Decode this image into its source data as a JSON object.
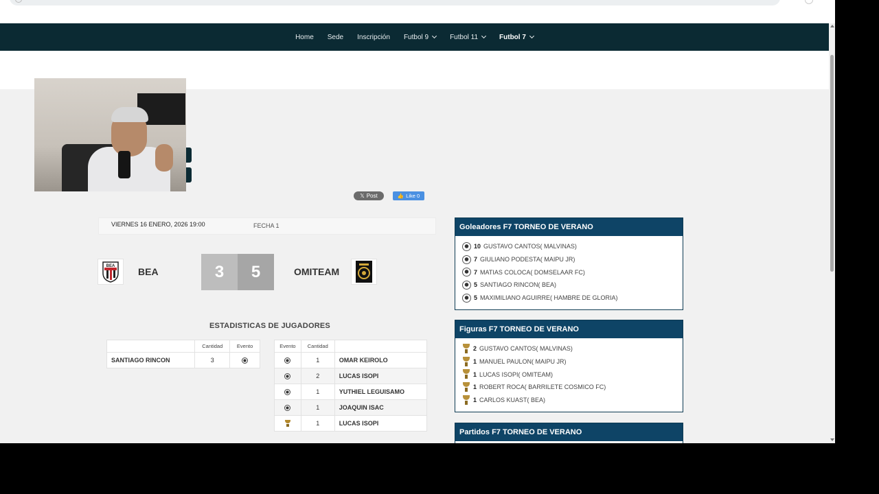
{
  "nav": {
    "items": [
      {
        "label": "Home"
      },
      {
        "label": "Sede"
      },
      {
        "label": "Inscripción"
      },
      {
        "label": "Futbol 9",
        "dropdown": true
      },
      {
        "label": "Futbol 11",
        "dropdown": true
      },
      {
        "label": "Futbol 7",
        "dropdown": true,
        "active": true
      }
    ]
  },
  "share": {
    "x_label": "Post",
    "fb_label": "Like 0"
  },
  "match": {
    "datetime": "VIERNES 16 ENERO, 2026 19:00",
    "round": "FECHA 1",
    "home_team": "BEA",
    "away_team": "OMITEAM",
    "home_score": "3",
    "away_score": "5",
    "home_logo_text": "BEA"
  },
  "stats": {
    "title": "ESTADISTICAS DE JUGADORES",
    "home": {
      "headers": {
        "col2": "Cantidad",
        "col3": "Evento"
      },
      "rows": [
        {
          "player": "SANTIAGO RINCON",
          "qty": "3",
          "event": "goal"
        }
      ]
    },
    "away": {
      "headers": {
        "col1": "Evento",
        "col2": "Cantidad"
      },
      "rows": [
        {
          "event": "goal",
          "qty": "1",
          "player": "OMAR KEIROLO"
        },
        {
          "event": "goal",
          "qty": "2",
          "player": "LUCAS ISOPI"
        },
        {
          "event": "goal",
          "qty": "1",
          "player": "YUTHIEL LEGUISAMO"
        },
        {
          "event": "goal",
          "qty": "1",
          "player": "JOAQUIN ISAC"
        },
        {
          "event": "figure",
          "qty": "1",
          "player": "LUCAS ISOPI"
        }
      ]
    }
  },
  "scorers": {
    "title": "Goleadores F7 TORNEO DE VERANO",
    "items": [
      {
        "count": "10",
        "name": "GUSTAVO CANTOS( MALVINAS)"
      },
      {
        "count": "7",
        "name": "GIULIANO PODESTA( MAIPU JR)"
      },
      {
        "count": "7",
        "name": "MATIAS COLOCA( DOMSELAAR FC)"
      },
      {
        "count": "5",
        "name": "SANTIAGO RINCON( BEA)"
      },
      {
        "count": "5",
        "name": "MAXIMILIANO AGUIRRE( HAMBRE DE GLORIA)"
      }
    ]
  },
  "figures": {
    "title": "Figuras F7 TORNEO DE VERANO",
    "items": [
      {
        "count": "2",
        "name": "GUSTAVO CANTOS( MALVINAS)"
      },
      {
        "count": "1",
        "name": "MANUEL PAULON( MAIPU JR)"
      },
      {
        "count": "1",
        "name": "LUCAS ISOPI( OMITEAM)"
      },
      {
        "count": "1",
        "name": "ROBERT ROCA( BARRILETE COSMICO FC)"
      },
      {
        "count": "1",
        "name": "CARLOS KUAST( BEA)"
      }
    ]
  },
  "matches_panel": {
    "title": "Partidos F7 TORNEO DE VERANO"
  },
  "colors": {
    "navbar": "#0b2a33",
    "panel_header": "#0e4466",
    "score_home_bg": "#bdbdbd",
    "score_away_bg": "#a6a6a6",
    "page_bg": "#f1f1f1"
  }
}
